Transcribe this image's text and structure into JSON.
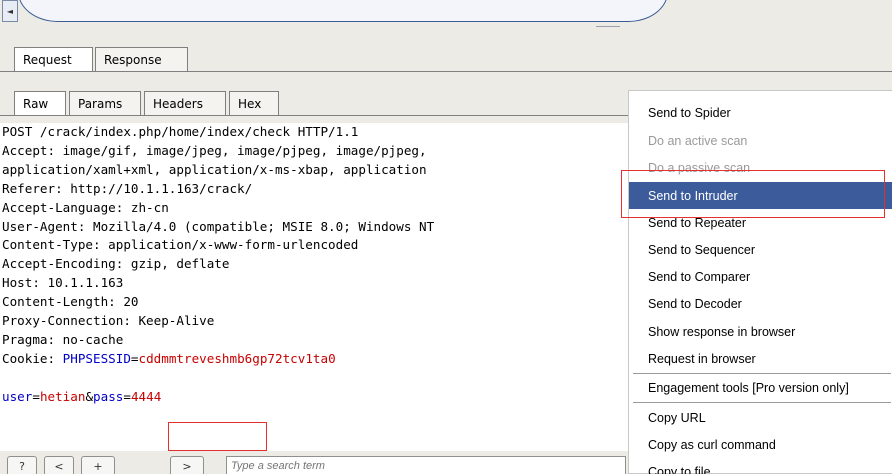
{
  "top_scroll": {
    "left_arrow": "◄"
  },
  "main_tabs": [
    {
      "label": "Request"
    },
    {
      "label": "Response"
    }
  ],
  "sub_tabs": [
    {
      "label": "Raw"
    },
    {
      "label": "Params"
    },
    {
      "label": "Headers"
    },
    {
      "label": "Hex"
    }
  ],
  "request": {
    "lines": [
      "POST /crack/index.php/home/index/check HTTP/1.1",
      "Accept: image/gif, image/jpeg, image/pjpeg, image/pjpeg,",
      "application/xaml+xml, application/x-ms-xbap, application",
      "Referer: http://10.1.1.163/crack/",
      "Accept-Language: zh-cn",
      "User-Agent: Mozilla/4.0 (compatible; MSIE 8.0; Windows NT",
      "Content-Type: application/x-www-form-urlencoded",
      "Accept-Encoding: gzip, deflate",
      "Host: 10.1.1.163",
      "Content-Length: 20",
      "Proxy-Connection: Keep-Alive",
      "Pragma: no-cache"
    ],
    "cookie": {
      "label": "Cookie: ",
      "name": "PHPSESSID",
      "eq": "=",
      "value": "cddmmtreveshmb6gp72tcv1ta0"
    },
    "body": {
      "k1": "user",
      "eq1": "=",
      "v1": "hetian",
      "amp": "&",
      "k2": "pass",
      "eq2": "=",
      "v2": "4444"
    }
  },
  "search": {
    "prev_label": "?",
    "back_label": "<",
    "add_label": "+",
    "next_label": ">",
    "placeholder": "Type a search term"
  },
  "context_menu": {
    "items": [
      {
        "label": "Send to Spider",
        "state": "normal"
      },
      {
        "label": "Do an active scan",
        "state": "disabled"
      },
      {
        "label": "Do a passive scan",
        "state": "disabled"
      },
      {
        "label": "Send to Intruder",
        "state": "selected"
      },
      {
        "label": "Send to Repeater",
        "state": "normal"
      },
      {
        "label": "Send to Sequencer",
        "state": "normal"
      },
      {
        "label": "Send to Comparer",
        "state": "normal"
      },
      {
        "label": "Send to Decoder",
        "state": "normal"
      },
      {
        "label": "Show response in browser",
        "state": "normal"
      },
      {
        "label": "Request in browser",
        "state": "normal"
      },
      {
        "label": "Engagement tools [Pro version only]",
        "state": "normal"
      },
      {
        "label": "Copy URL",
        "state": "normal"
      },
      {
        "label": "Copy as curl command",
        "state": "normal"
      },
      {
        "label": "Copy to file",
        "state": "normal"
      }
    ]
  },
  "colors": {
    "highlight": "#e53030",
    "selection": "#3b5b9a",
    "param_name": "#0000c8",
    "param_value": "#c80000"
  }
}
